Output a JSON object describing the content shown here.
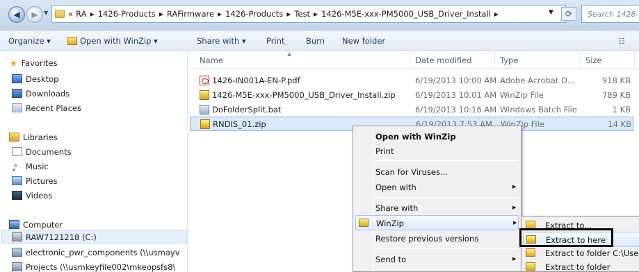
{
  "address": {
    "recent_glyph": "«",
    "crumbs": [
      "RA",
      "1426-Products",
      "RAFirmware",
      "1426-Products",
      "Test",
      "1426-M5E-xxx-PM5000_USB_Driver_Install"
    ],
    "search_placeholder": "Search 1426-M"
  },
  "toolbar": {
    "organize": "Organize ▾",
    "open_with": "Open with WinZip ▾",
    "share_with": "Share with ▾",
    "print": "Print",
    "burn": "Burn",
    "new_folder": "New folder"
  },
  "nav": {
    "favorites": "Favorites",
    "desktop": "Desktop",
    "downloads": "Downloads",
    "recent_places": "Recent Places",
    "libraries": "Libraries",
    "documents": "Documents",
    "music": "Music",
    "pictures": "Pictures",
    "videos": "Videos",
    "computer": "Computer",
    "drive_c": "RAW7121218 (C:)",
    "net1": "electronic_pwr_components (\\\\usmayv",
    "net2": "Projects (\\\\usmkeyfile002\\mkeopsfs8\\"
  },
  "columns": {
    "name": "Name",
    "date": "Date modified",
    "type": "Type",
    "size": "Size"
  },
  "files": [
    {
      "name": "1426-IN001A-EN-P.pdf",
      "date": "6/19/2013 10:00 AM",
      "type": "Adobe Acrobat D...",
      "size": "918 KB"
    },
    {
      "name": "1426-M5E-xxx-PM5000_USB_Driver_Install.zip",
      "date": "6/19/2013 10:01 AM",
      "type": "WinZip File",
      "size": "789 KB"
    },
    {
      "name": "DoFolderSplit.bat",
      "date": "6/19/2013 10:16 AM",
      "type": "Windows Batch File",
      "size": "1 KB"
    },
    {
      "name": "RNDIS_01.zip",
      "date": "6/19/2013 7:53 AM",
      "type": "WinZip File",
      "size": "14 KB"
    }
  ],
  "context_menu": {
    "open_with_winzip": "Open with WinZip",
    "print": "Print",
    "scan": "Scan for Viruses...",
    "open_with": "Open with",
    "share_with": "Share with",
    "winzip": "WinZip",
    "restore": "Restore previous versions",
    "send_to": "Send to"
  },
  "submenu": {
    "extract_to": "Extract to...",
    "extract_here": "Extract to here",
    "extract_folder_c": "Extract to folder C:\\Users\\",
    "extract_folder": "Extract to folder"
  }
}
